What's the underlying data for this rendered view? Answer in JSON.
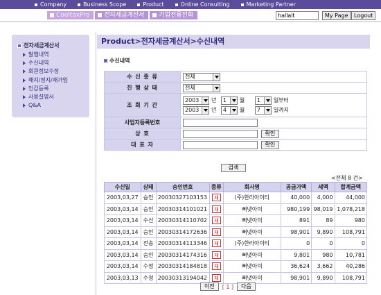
{
  "top_nav": [
    "Company",
    "Business Scope",
    "Product",
    "Online Consulting",
    "Marketing Partner"
  ],
  "sub_nav": {
    "tabs": [
      "CooltaxPro",
      "전자세금계산서",
      "기업전용전화"
    ]
  },
  "header": {
    "search_value": "hallait",
    "mypage_label": "My Page",
    "logout_label": "Logout"
  },
  "sidebar": {
    "title": "전자세금계산서",
    "items": [
      "발행내역",
      "수신내역",
      "회원정보수정",
      "해지/정지/재가입",
      "인감등록",
      "사용설명서",
      "Q&A"
    ]
  },
  "page": {
    "title": "Product>전자세금계산서>수신내역",
    "section_title": "수신내역"
  },
  "form": {
    "receive_type": {
      "label": "수 신 종 류",
      "value": "전체"
    },
    "progress_status": {
      "label": "진 행 상 태",
      "value": "전체"
    },
    "period": {
      "label": "조 회 기 간",
      "from": {
        "year": "2003",
        "month": "1",
        "day": "1"
      },
      "to": {
        "year": "2003",
        "month": "4",
        "day": "7"
      },
      "year_unit": "년",
      "month_unit": "월",
      "from_suffix": "일부터",
      "to_suffix": "일까지"
    },
    "biz_number": {
      "label": "사업자등록번호",
      "value": ""
    },
    "company": {
      "label": "상 호",
      "value": "",
      "button": "확인"
    },
    "representative": {
      "label": "대 표 자",
      "value": "",
      "button": "확인"
    },
    "search_button": "검색"
  },
  "results": {
    "total_label": "<전체 8 건>",
    "columns": [
      "수신일",
      "상태",
      "승인번호",
      "종류",
      "회사명",
      "공급가액",
      "세액",
      "합계금액"
    ],
    "rows": [
      {
        "date": "2003,03,27",
        "status": "승인",
        "approval_no": "20030327103153",
        "kind": "재",
        "company": "(주)한라아이티",
        "supply": "40,000",
        "tax": "4,000",
        "total": "44,000"
      },
      {
        "date": "2003,03,14",
        "status": "승인",
        "approval_no": "20030314101021",
        "kind": "재",
        "company": "뻐냇아이",
        "supply": "980,199",
        "tax": "98,019",
        "total": "1,078,218"
      },
      {
        "date": "2003,03,14",
        "status": "수신",
        "approval_no": "20030314110702",
        "kind": "재",
        "company": "뻐냇아이",
        "supply": "891",
        "tax": "89",
        "total": "980"
      },
      {
        "date": "2003,03,14",
        "status": "승인",
        "approval_no": "20030314172636",
        "kind": "재",
        "company": "뻐냇아이",
        "supply": "98,901",
        "tax": "9,890",
        "total": "108,791"
      },
      {
        "date": "2003,03,14",
        "status": "전송",
        "approval_no": "20030314113346",
        "kind": "재",
        "company": "(주)한라아이티",
        "supply": "0",
        "tax": "0",
        "total": "0"
      },
      {
        "date": "2003,03,14",
        "status": "승인",
        "approval_no": "20030314174316",
        "kind": "재",
        "company": "뻐냇아이",
        "supply": "9,801",
        "tax": "980",
        "total": "10,781"
      },
      {
        "date": "2003,03,14",
        "status": "수정",
        "approval_no": "20030314184818",
        "kind": "재",
        "company": "뻐냇아이",
        "supply": "36,624",
        "tax": "3,662",
        "total": "40,286"
      },
      {
        "date": "2003,03,13",
        "status": "수정",
        "approval_no": "20030313194042",
        "kind": "재",
        "company": "뻐냇아이",
        "supply": "98,901",
        "tax": "9,890",
        "total": "108,791"
      }
    ]
  },
  "pagination": {
    "prev_label": "이전",
    "current": "[ 1 ]",
    "next_label": "다음"
  },
  "colors": {
    "nav_bg": "#5b4b9b",
    "tab_bg": "#b493d6",
    "panel_bg": "#d9d5ee",
    "header_cell": "#d5d3ed",
    "badge_red": "#c02828"
  }
}
